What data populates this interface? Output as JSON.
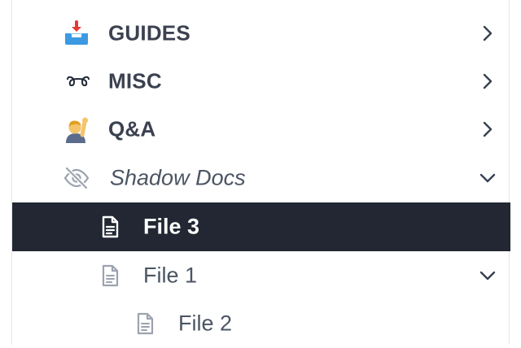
{
  "sidebar": {
    "items": [
      {
        "label": "GUIDES",
        "icon": "inbox-tray-icon",
        "expanded": false
      },
      {
        "label": "MISC",
        "icon": "curly-loop-icon",
        "expanded": false
      },
      {
        "label": "Q&A",
        "icon": "raising-hand-person-icon",
        "expanded": false
      },
      {
        "label": "Shadow Docs",
        "icon": "eye-slash-icon",
        "expanded": true
      }
    ],
    "files": [
      {
        "label": "File 3",
        "icon": "document-icon",
        "active": true
      },
      {
        "label": "File 1",
        "icon": "document-icon",
        "active": false,
        "expanded": true
      },
      {
        "label": "File 2",
        "icon": "document-icon",
        "active": false
      }
    ]
  },
  "colors": {
    "active_bg": "#222733",
    "text": "#3b4150",
    "muted": "#6b7280"
  }
}
